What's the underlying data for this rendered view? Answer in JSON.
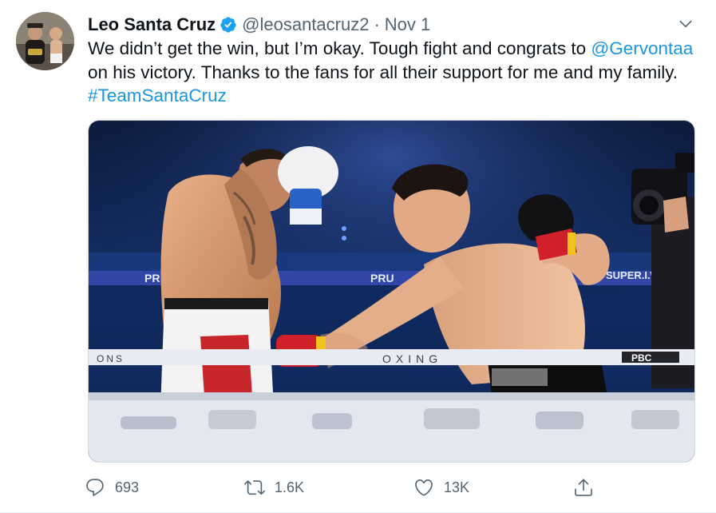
{
  "tweet": {
    "display_name": "Leo Santa Cruz",
    "handle": "@leosantacruz2",
    "separator": "·",
    "timestamp": "Nov 1",
    "text_part1": "We didn’t get the win, but I’m okay. Tough fight and congrats to ",
    "mention": "@Gervontaa",
    "text_part2": " on his victory. Thanks to the fans for all their support for me and my family. ",
    "hashtag": "#TeamSantaCruz",
    "ring_rope_text_left": "PR",
    "ring_rope_text_mid": "PRU",
    "ring_rope_text_right": "SUPER.I.WEL",
    "ring_lower_left": "ONS",
    "ring_lower_mid": "OXING",
    "ring_lower_right": "PBC"
  },
  "actions": {
    "reply_count": "693",
    "retweet_count": "1.6K",
    "like_count": "13K"
  },
  "icons": {
    "verified": "verified-badge-icon",
    "caret": "chevron-down-icon",
    "reply": "reply-icon",
    "retweet": "retweet-icon",
    "like": "heart-icon",
    "share": "share-icon"
  },
  "colors": {
    "link": "#1b95e0",
    "muted": "#536471",
    "verified": "#1da1f2"
  }
}
